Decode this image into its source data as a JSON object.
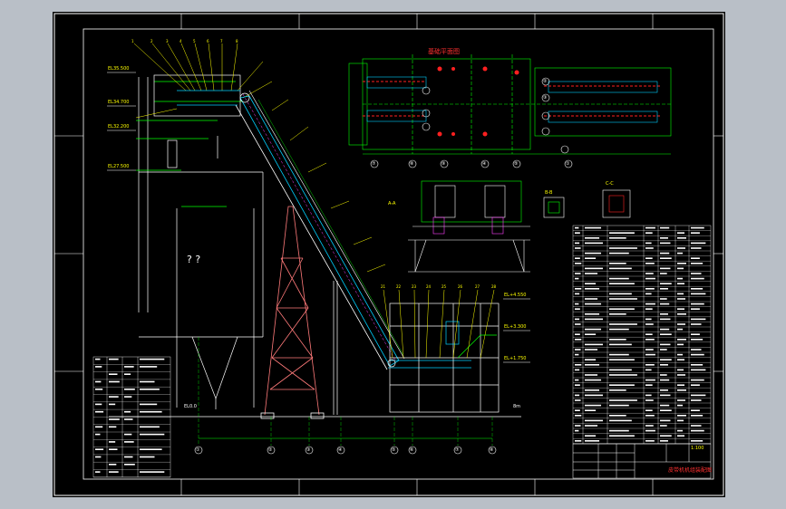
{
  "colors": {
    "workspace_bg": "#b9bfc7",
    "sheet_bg": "#000000",
    "frame": "#ffffff",
    "main_lines": "#00ff00",
    "structure": "#ffffff",
    "belt": "#00d0ff",
    "accent_red": "#ff2020",
    "accent_magenta": "#ff40ff",
    "accent_yellow": "#ffff00"
  },
  "labels": {
    "plan_title": "基础平面图",
    "question_marks": "? ?",
    "scale_note": "1:100",
    "title_block_name": "皮带机机组装配图",
    "dim_left": "EL0.0",
    "dim_right": "8m"
  },
  "axis_bubbles_bottom": [
    "①",
    "②",
    "③",
    "④",
    "⑤",
    "⑥",
    "⑦",
    "⑧",
    "⑨"
  ],
  "axis_bubbles_plan": [
    "⑦",
    "⑧",
    "⑨",
    "④",
    "⑤",
    "①",
    "②",
    "③"
  ],
  "elevation_tags": [
    "EL35.500",
    "EL34.700",
    "EL32.200",
    "EL27.500",
    "EL+4.550",
    "EL+3.300",
    "EL+1.750"
  ],
  "views": {
    "section_a": "A-A",
    "section_b": "B-B",
    "section_c": "C-C"
  }
}
